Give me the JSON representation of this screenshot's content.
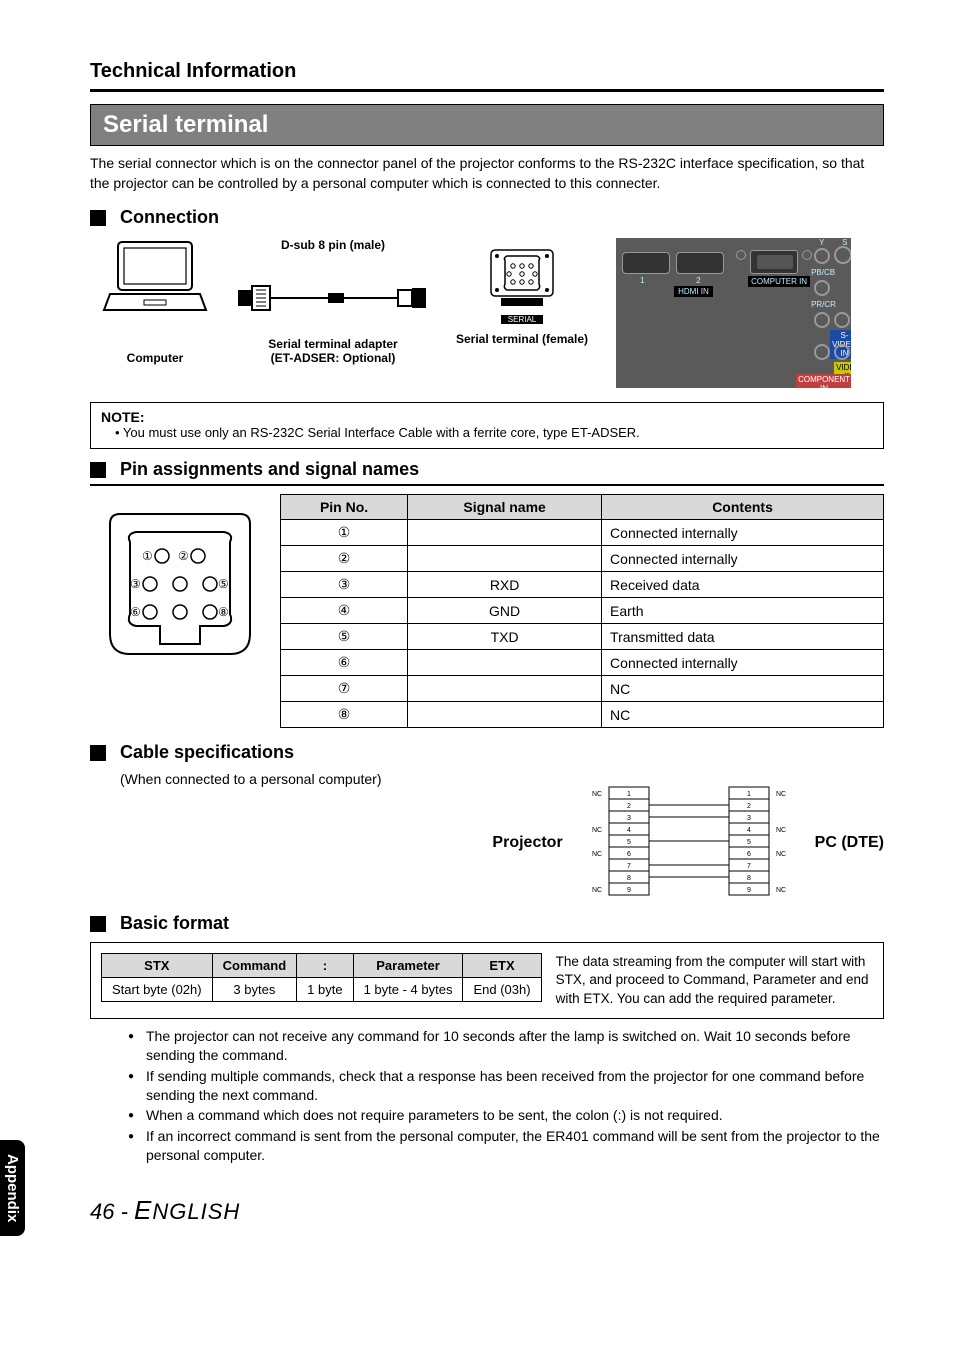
{
  "page_title": "Technical Information",
  "section_title": "Serial terminal",
  "intro_text": "The serial connector which is on the connector panel of the projector conforms to the RS-232C interface specification, so that the projector can be controlled by a personal computer which is connected to this connecter.",
  "subsections": {
    "connection": "Connection",
    "pin_assignments": "Pin assignments and signal names",
    "cable_specifications": "Cable specifications",
    "basic_format": "Basic format"
  },
  "connection": {
    "dsub_label": "D-sub 8 pin (male)",
    "computer_label": "Computer",
    "adapter_label_line1": "Serial terminal adapter",
    "adapter_label_line2": "(ET-ADSER: Optional)",
    "serial_female_label": "Serial terminal (female)",
    "panel_text": {
      "serial": "SERIAL",
      "hdmi": "HDMI IN",
      "computer_in": "COMPUTER IN",
      "svideo": "S-VIDEO IN",
      "video": "VIDEO IN",
      "component": "COMPONENT IN",
      "y": "Y",
      "s": "S",
      "pbcb": "PB/CB",
      "prcr": "PR/CR",
      "n1": "1",
      "n2": "2"
    }
  },
  "note": {
    "title": "NOTE:",
    "body": "• You must use only an RS-232C Serial Interface Cable with a ferrite core, type ET-ADSER."
  },
  "pin_table": {
    "headers": {
      "pin": "Pin No.",
      "signal": "Signal name",
      "contents": "Contents"
    },
    "rows": [
      {
        "pin": "①",
        "signal": "",
        "contents": "Connected internally"
      },
      {
        "pin": "②",
        "signal": "",
        "contents": "Connected internally"
      },
      {
        "pin": "③",
        "signal": "RXD",
        "contents": "Received data"
      },
      {
        "pin": "④",
        "signal": "GND",
        "contents": "Earth"
      },
      {
        "pin": "⑤",
        "signal": "TXD",
        "contents": "Transmitted data"
      },
      {
        "pin": "⑥",
        "signal": "",
        "contents": "Connected internally"
      },
      {
        "pin": "⑦",
        "signal": "",
        "contents": "NC"
      },
      {
        "pin": "⑧",
        "signal": "",
        "contents": "NC"
      }
    ],
    "diagram_labels": {
      "p1": "①",
      "p2": "②",
      "p3": "③",
      "p5": "⑤",
      "p6": "⑥",
      "p8": "⑧"
    }
  },
  "cable_spec": {
    "sub_note": "(When connected to a personal computer)",
    "projector_label": "Projector",
    "pc_label": "PC (DTE)",
    "pins": [
      "1",
      "2",
      "3",
      "4",
      "5",
      "6",
      "7",
      "8",
      "9"
    ],
    "nc_left_rows": [
      "1",
      "4",
      "6",
      "9"
    ],
    "nc_right_rows": [
      "1",
      "4",
      "6",
      "9"
    ],
    "nc": "NC"
  },
  "basic_format": {
    "headers": {
      "stx": "STX",
      "command": "Command",
      "colon": ":",
      "parameter": "Parameter",
      "etx": "ETX"
    },
    "row2": {
      "stx": "Start byte (02h)",
      "command": "3 bytes",
      "colon": "1 byte",
      "parameter": "1 byte - 4 bytes",
      "etx": "End (03h)"
    },
    "desc": "The data streaming from the computer will start with STX, and proceed to Command, Parameter and end with ETX. You can add the required parameter."
  },
  "format_bullets": [
    "The projector can not receive any command for 10 seconds after the lamp is switched on. Wait 10 seconds before sending the command.",
    "If sending multiple commands, check that a response has been received from the projector for one command before sending the next command.",
    "When a command which does not require parameters to be sent, the colon (:) is not required.",
    "If an incorrect command is sent from the personal computer, the ER401 command will be sent from the projector to the personal computer."
  ],
  "side_tab": "Appendix",
  "page_footer": {
    "num": "46",
    "sep": " - ",
    "lang_first": "E",
    "lang_rest": "NGLISH"
  }
}
